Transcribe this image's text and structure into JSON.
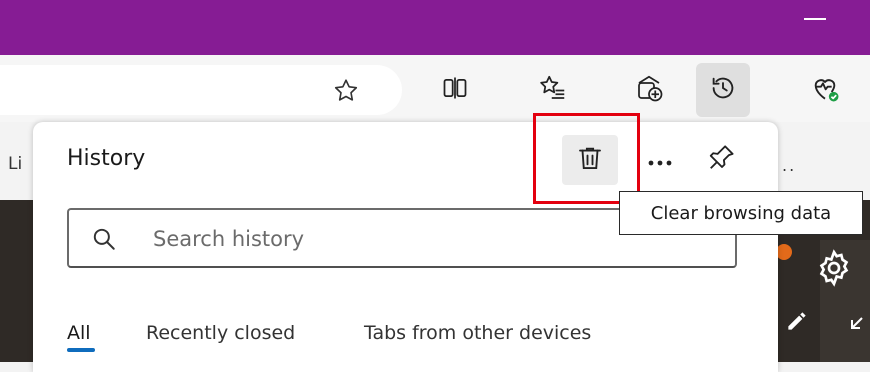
{
  "window": {
    "minimize_icon": "minimize-icon",
    "titlebar_color": "#861c94"
  },
  "toolbar": {
    "favorite_icon": "star-outline-icon",
    "split_screen_icon": "split-screen-icon",
    "favorites_icon": "favorites-list-icon",
    "collections_icon": "collections-add-icon",
    "history_icon": "history-clock-icon",
    "health_icon": "browser-essentials-heart-icon"
  },
  "bookmarks": {
    "left_truncated": "Li",
    "right_overflow": ".."
  },
  "history_panel": {
    "title": "History",
    "delete_icon": "trash-icon",
    "more_icon": "more-options-icon",
    "pin_icon": "pin-icon",
    "search": {
      "placeholder": "Search history",
      "value": ""
    },
    "tabs": [
      {
        "label": "All",
        "active": true
      },
      {
        "label": "Recently closed",
        "active": false
      },
      {
        "label": "Tabs from other devices",
        "active": false
      }
    ],
    "accent_color": "#0f6cbd"
  },
  "tooltip": {
    "text": "Clear browsing data"
  },
  "annotation": {
    "highlight_color": "#e3000f"
  }
}
